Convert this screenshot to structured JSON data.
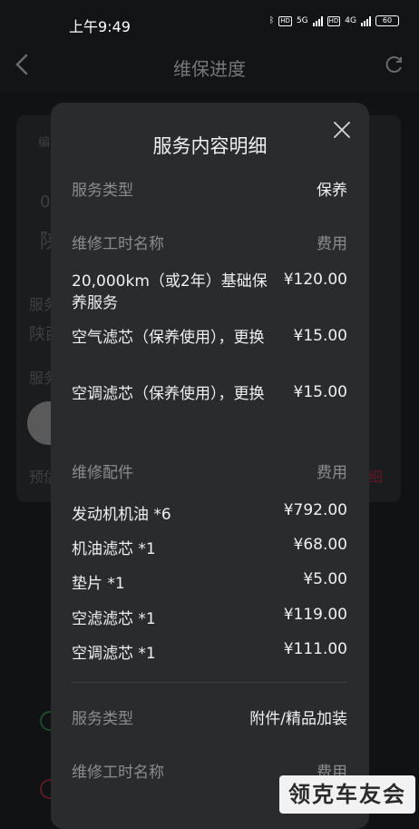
{
  "status_bar": {
    "time": "上午9:49",
    "network1": "5G",
    "network2": "4G",
    "battery": "60"
  },
  "header": {
    "title": "维保进度"
  },
  "background": {
    "frag1": "编",
    "frag2": "0",
    "frag3": "陕",
    "frag4": "服务",
    "frag5": "陕西",
    "frag6": "服务",
    "frag7": "预估",
    "frag8": "细"
  },
  "modal": {
    "title": "服务内容明细",
    "section1": {
      "type_label": "服务类型",
      "type_value": "保养",
      "labor_header": "维修工时名称",
      "fee_header": "费用",
      "labor_items": [
        {
          "name": "20,000km（或2年）基础保养服务",
          "fee": "¥120.00"
        },
        {
          "name": "空气滤芯（保养使用），更换",
          "fee": "¥15.00"
        },
        {
          "name": "空调滤芯（保养使用），更换",
          "fee": "¥15.00"
        }
      ],
      "parts_header": "维修配件",
      "parts_fee_header": "费用",
      "parts": [
        {
          "name": "发动机机油 *6",
          "fee": "¥792.00"
        },
        {
          "name": "机油滤芯 *1",
          "fee": "¥68.00"
        },
        {
          "name": "垫片 *1",
          "fee": "¥5.00"
        },
        {
          "name": "空滤滤芯 *1",
          "fee": "¥119.00"
        },
        {
          "name": "空调滤芯 *1",
          "fee": "¥111.00"
        }
      ]
    },
    "section2": {
      "type_label": "服务类型",
      "type_value": "附件/精品加装",
      "labor_header": "维修工时名称",
      "fee_header": "费用"
    }
  },
  "watermark": "领克车友会"
}
